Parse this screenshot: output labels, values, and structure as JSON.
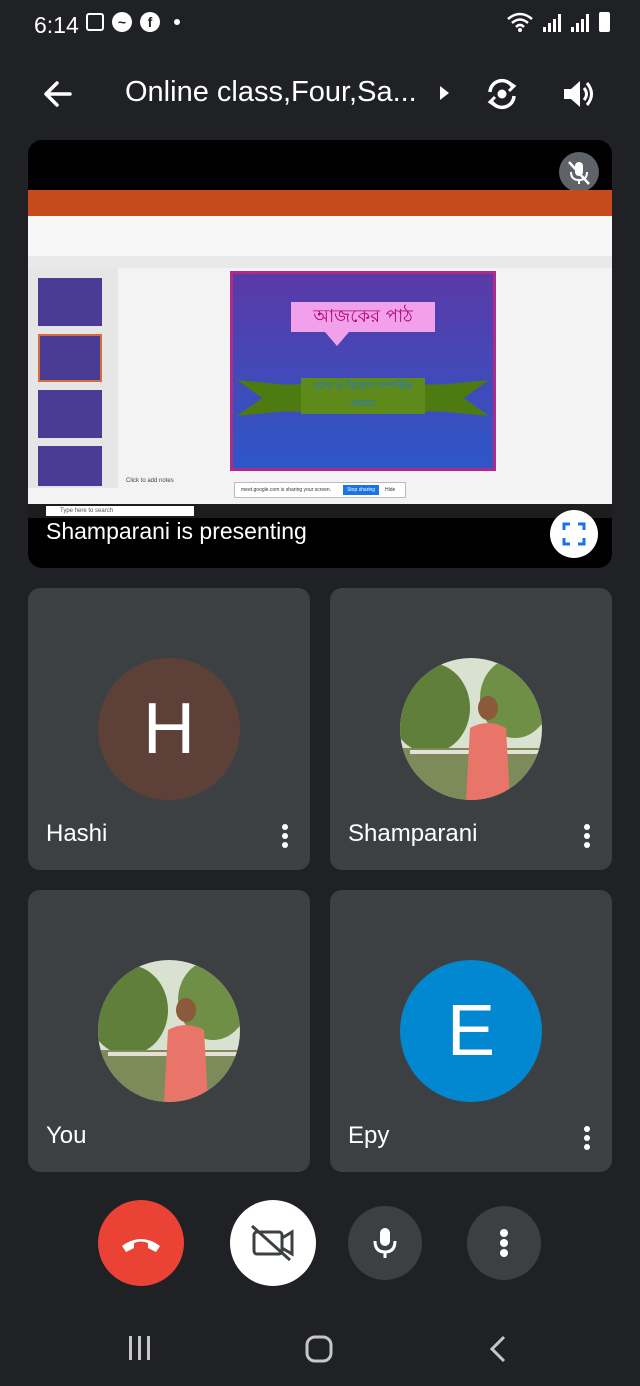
{
  "status_bar": {
    "time": "6:14",
    "notification_icons": [
      "gallery-icon",
      "messenger-icon",
      "facebook-icon",
      "dot-icon"
    ],
    "system_icons": [
      "wifi-icon",
      "signal-icon",
      "signal-icon",
      "battery-icon"
    ]
  },
  "header": {
    "meeting_title": "Online class,Four,Sa...",
    "icons": [
      "back-arrow-icon",
      "expand-arrow-icon",
      "switch-camera-icon",
      "speaker-icon"
    ]
  },
  "presentation": {
    "presenter_text": "Shamparani is presenting",
    "slide_title": "আজকের পাঠ",
    "slide_subtitle": "যোগ ও বিয়োগ সম্পর্কিত সমস্যা",
    "notes_placeholder": "Click to add notes",
    "share_notice": "meet.google.com is sharing your screen.",
    "stop_sharing": "Stop sharing",
    "hide": "Hide",
    "taskbar_search": "Type here to search"
  },
  "participants": [
    {
      "name": "Hashi",
      "initial": "H",
      "avatar_color": "#5d4037"
    },
    {
      "name": "Shamparani",
      "initial": "",
      "avatar_color": "#6e8a4a"
    },
    {
      "name": "You",
      "initial": "",
      "avatar_color": "#6e8a4a"
    },
    {
      "name": "Epy",
      "initial": "E",
      "avatar_color": "#0288d1"
    }
  ],
  "controls": {
    "end_call_color": "#ea4335",
    "camera_off_bg": "#ffffff",
    "button_bg": "#3c4043"
  }
}
